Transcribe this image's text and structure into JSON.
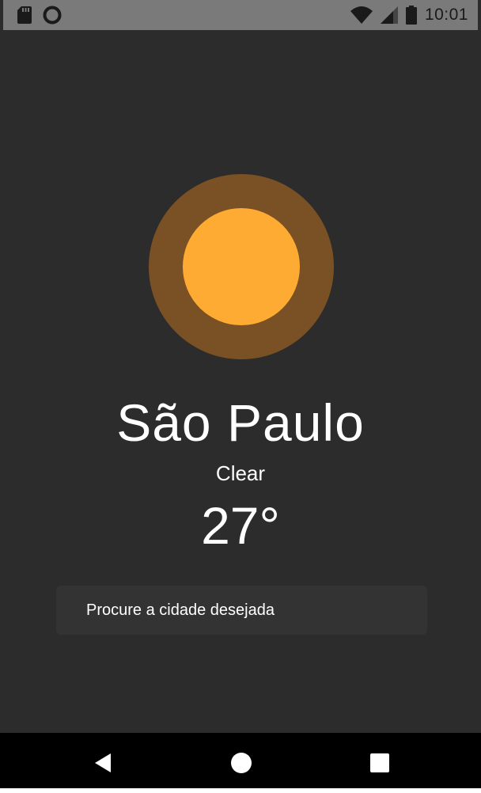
{
  "status_bar": {
    "time": "10:01",
    "left_icons": [
      "sd-card-icon",
      "circle-record-icon"
    ],
    "right_icons": [
      "wifi-icon",
      "cell-signal-icon",
      "battery-icon"
    ],
    "background": "#7a7a7a"
  },
  "weather": {
    "city": "São Paulo",
    "condition": "Clear",
    "temperature": "27°",
    "icon": "sun-icon",
    "sun_outer_color": "#7a5124",
    "sun_inner_color": "#fdab33"
  },
  "search": {
    "placeholder": "Procure a cidade desejada"
  },
  "navigation": {
    "buttons": [
      "back-icon",
      "home-icon",
      "recents-icon"
    ]
  },
  "colors": {
    "background": "#2c2c2c",
    "text": "#ffffff"
  }
}
